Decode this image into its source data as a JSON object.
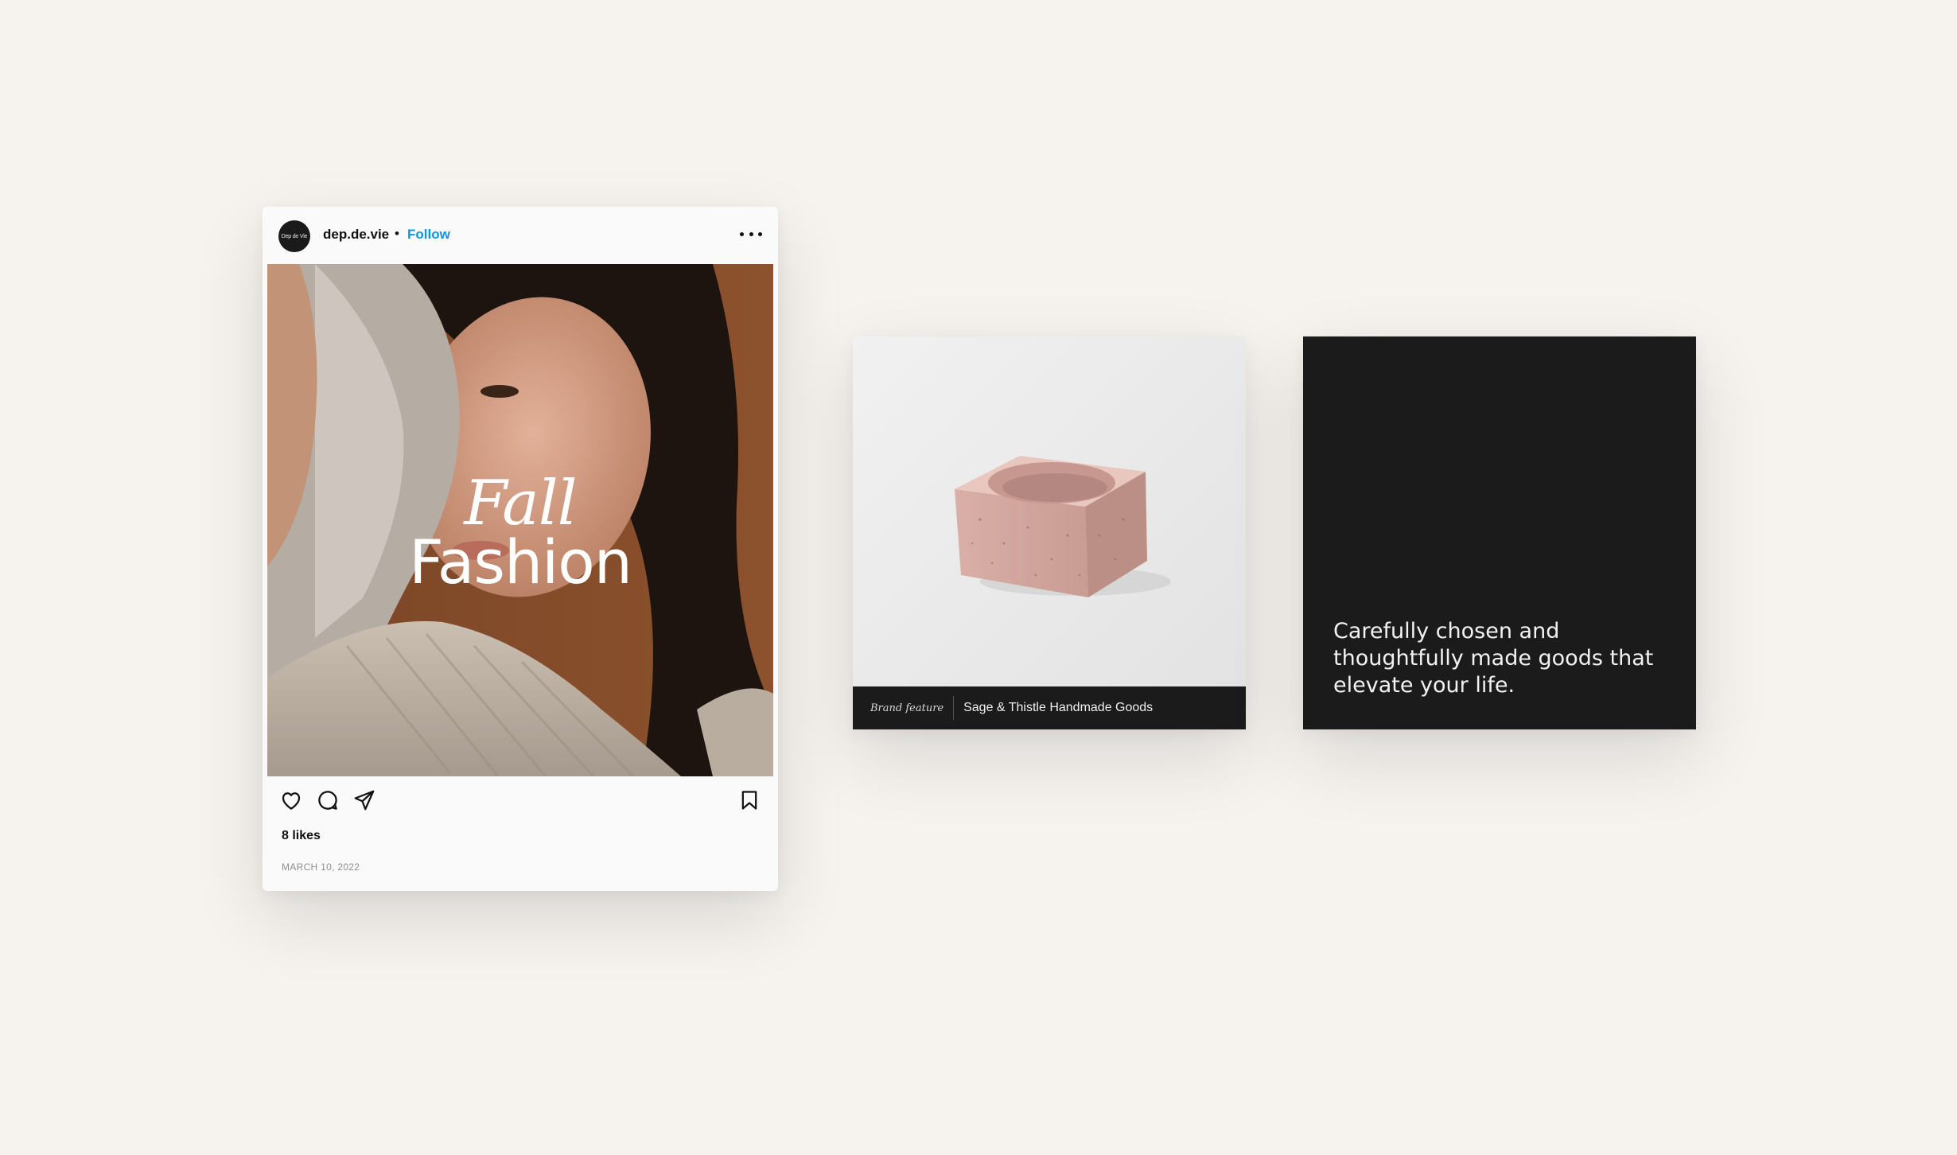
{
  "post": {
    "avatar_text": "Dep de Vie",
    "username": "dep.de.vie",
    "separator": "•",
    "follow_label": "Follow",
    "headline_line1": "Fall",
    "headline_line2": "Fashion",
    "likes": "8 likes",
    "date": "MARCH 10, 2022",
    "icons": [
      "heart-icon",
      "comment-icon",
      "send-icon",
      "bookmark-icon",
      "more-icon"
    ],
    "follow_color": "#0a95e6"
  },
  "product_card": {
    "tag": "Brand feature",
    "title": "Sage & Thistle Handmade Goods"
  },
  "quote_card": {
    "text": "Carefully chosen and thoughtfully made goods that elevate your life."
  },
  "colors": {
    "background": "#f6f3ef",
    "dark_card": "#1b1b1b",
    "photo_backdrop": "#8a4e2a"
  }
}
